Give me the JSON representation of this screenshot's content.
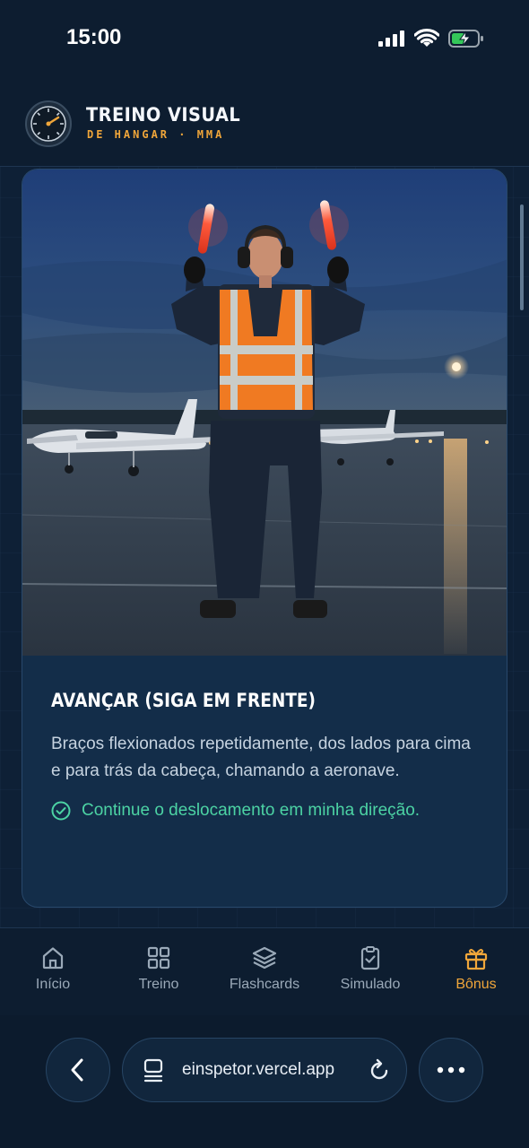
{
  "status_bar": {
    "time": "15:00",
    "icons": [
      "signal-icon",
      "wifi-icon",
      "battery-charging-icon"
    ]
  },
  "header": {
    "logo": "gauge-logo",
    "title": "TREINO VISUAL",
    "subtitle": "DE HANGAR · MMA"
  },
  "card": {
    "image": "marshaller-photo",
    "title": "AVANÇAR (SIGA EM FRENTE)",
    "description": "Braços flexionados repetidamente, dos lados para cima e para trás da cabeça, chamando a aeronave.",
    "meaning": "Continue o deslocamento em minha direção.",
    "meaning_icon": "check-circle-icon"
  },
  "bottom_nav": {
    "items": [
      {
        "label": "Início",
        "icon": "home-icon"
      },
      {
        "label": "Treino",
        "icon": "grid-icon"
      },
      {
        "label": "Flashcards",
        "icon": "layers-icon"
      },
      {
        "label": "Simulado",
        "icon": "clipboard-check-icon"
      },
      {
        "label": "Bônus",
        "icon": "gift-icon",
        "active": true
      }
    ]
  },
  "browser": {
    "url": "einspetor.vercel.app",
    "back_icon": "chevron-left-icon",
    "tabs_icon": "tabs-icon",
    "reload_icon": "reload-icon",
    "more_icon": "more-icon"
  },
  "colors": {
    "accent": "#f0a63a",
    "success": "#4cd3a4",
    "background": "#0e2036",
    "card": "#132d49"
  }
}
